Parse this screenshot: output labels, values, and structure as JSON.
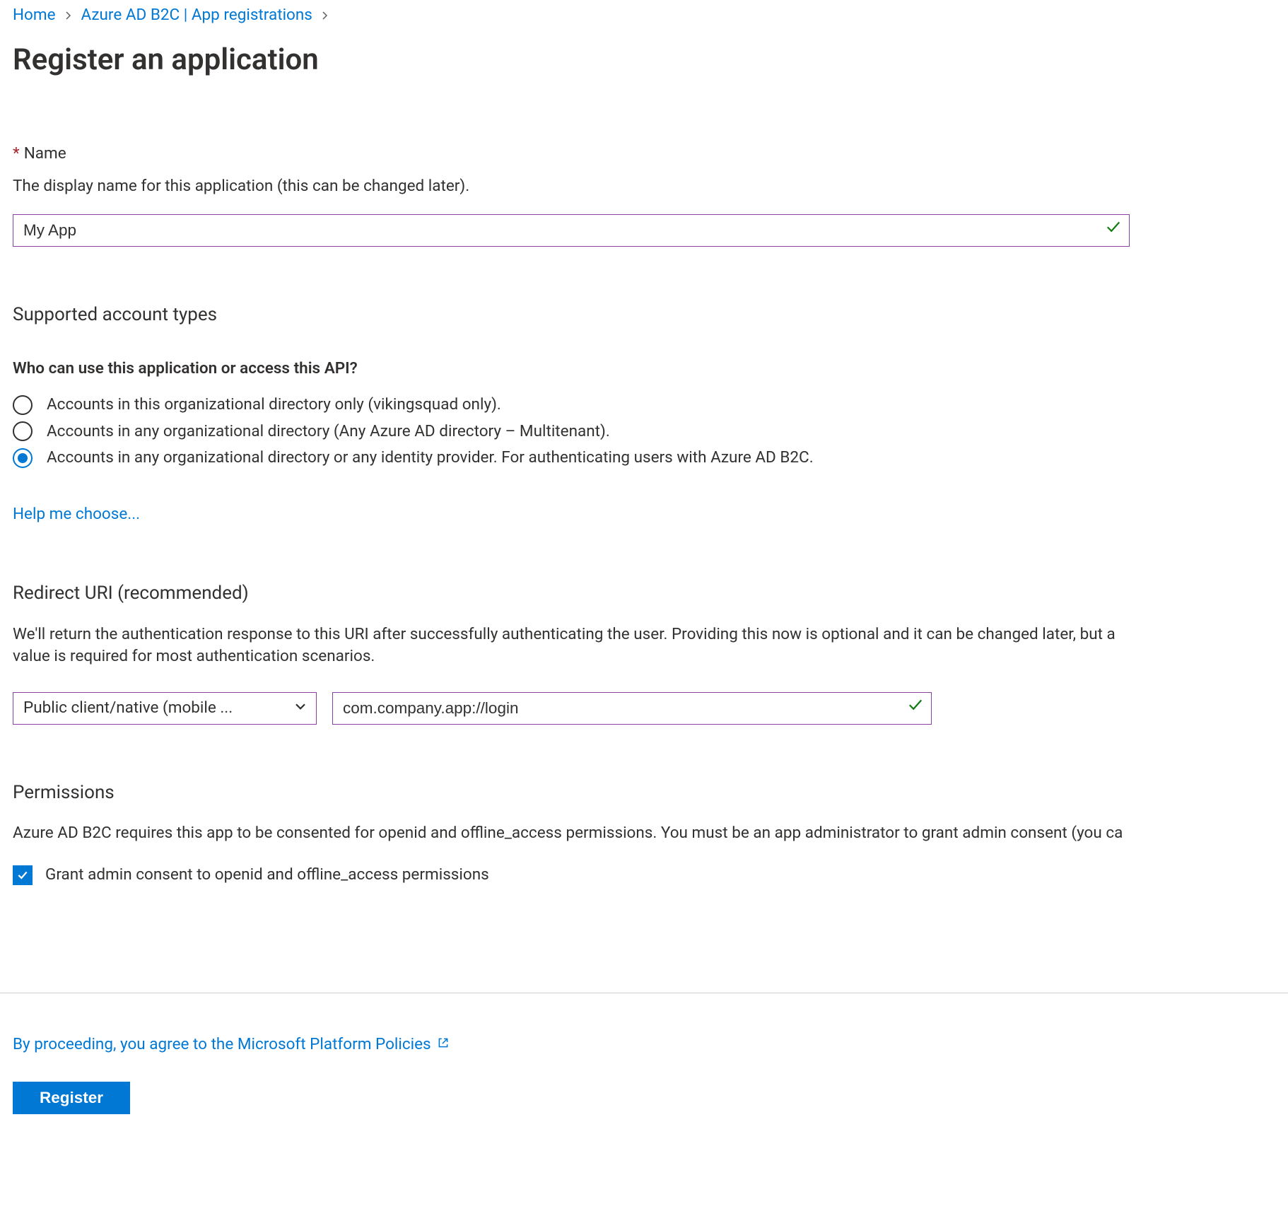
{
  "breadcrumb": {
    "home": "Home",
    "b2c": "Azure AD B2C | App registrations"
  },
  "page_title": "Register an application",
  "name_section": {
    "label": "Name",
    "help": "The display name for this application (this can be changed later).",
    "value": "My App"
  },
  "account_types": {
    "title": "Supported account types",
    "subhead": "Who can use this application or access this API?",
    "options": [
      "Accounts in this organizational directory only (vikingsquad only).",
      "Accounts in any organizational directory (Any Azure AD directory – Multitenant).",
      "Accounts in any organizational directory or any identity provider. For authenticating users with Azure AD B2C."
    ],
    "selected_index": 2,
    "help_link": "Help me choose..."
  },
  "redirect": {
    "title": "Redirect URI (recommended)",
    "description": "We'll return the authentication response to this URI after successfully authenticating the user. Providing this now is optional and it can be changed later, but a value is required for most authentication scenarios.",
    "platform_selected": "Public client/native (mobile ...",
    "uri_value": "com.company.app://login"
  },
  "permissions": {
    "title": "Permissions",
    "description": "Azure AD B2C requires this app to be consented for openid and offline_access permissions. You must be an app administrator to grant admin consent (you ca",
    "checkbox_label": "Grant admin consent to openid and offline_access permissions",
    "checked": true
  },
  "footer": {
    "policies_link": "By proceeding, you agree to the Microsoft Platform Policies",
    "register_button": "Register"
  }
}
